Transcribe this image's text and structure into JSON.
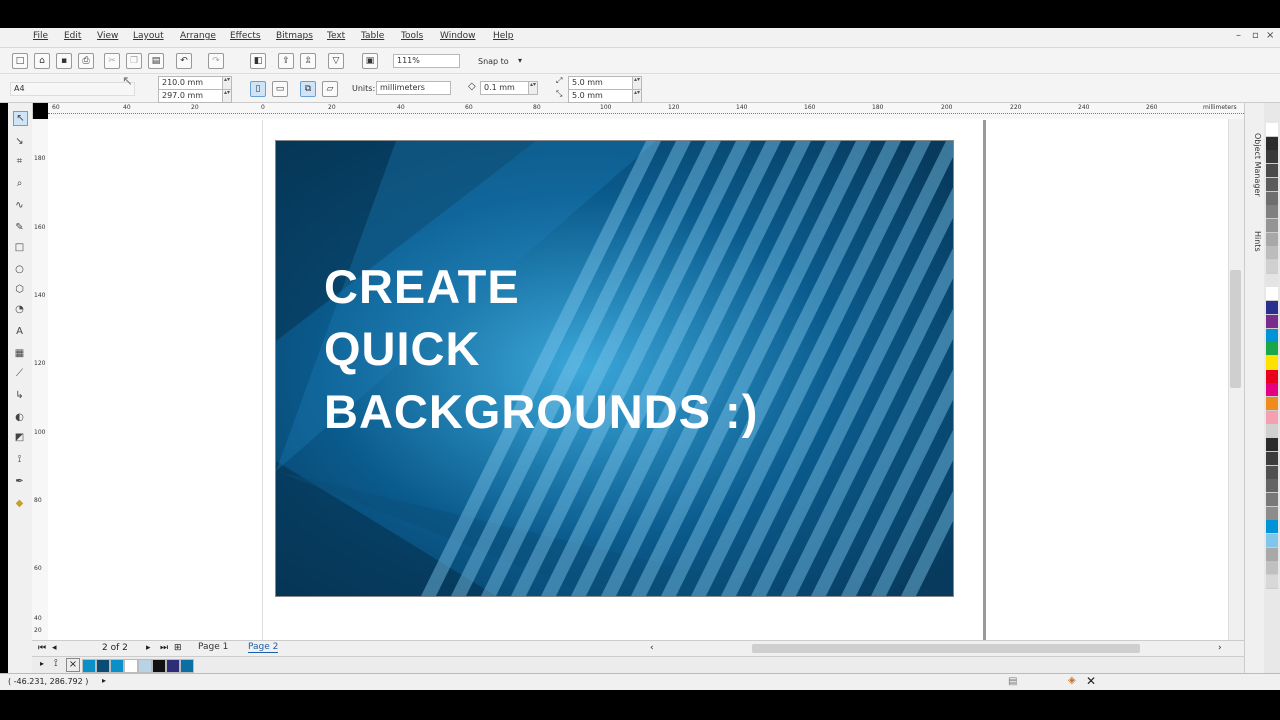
{
  "menu": [
    "File",
    "Edit",
    "View",
    "Layout",
    "Arrange",
    "Effects",
    "Bitmaps",
    "Text",
    "Table",
    "Tools",
    "Window",
    "Help"
  ],
  "toolbar": {
    "zoom": "111%",
    "snap_label": "Snap to"
  },
  "propbar": {
    "page_size": "A4",
    "width": "210.0 mm",
    "height": "297.0 mm",
    "units_label": "Units:",
    "units_value": "millimeters",
    "nudge": "0.1 mm",
    "dup_x": "5.0 mm",
    "dup_y": "5.0 mm"
  },
  "ruler": {
    "h_ticks": [
      "60",
      "40",
      "20",
      "0",
      "20",
      "40",
      "60",
      "80",
      "100",
      "120",
      "140",
      "160",
      "180",
      "200",
      "220",
      "240",
      "260"
    ],
    "units": "millimeters",
    "v_ticks": [
      "180",
      "160",
      "140",
      "120",
      "100",
      "80",
      "60",
      "40",
      "20"
    ]
  },
  "artwork": {
    "lines": [
      "CREATE",
      "QUICK",
      "BACKGROUNDS :)"
    ],
    "colors": {
      "dark": "#073a5c",
      "mid": "#0a5a8c",
      "light": "#3ba7d9",
      "stripe": "#7fc6ea"
    }
  },
  "dockers": [
    "Object Manager",
    "Hints"
  ],
  "pagenav": {
    "count": "2 of 2",
    "tabs": [
      "Page 1",
      "Page 2"
    ]
  },
  "document_palette": [
    "#0b8fc7",
    "#0a4c74",
    "#0a90c9",
    "#ffffff",
    "#b9d3e6",
    "#111111",
    "#2d2d78",
    "#0b6fa3"
  ],
  "palette": [
    "#ffffff",
    "#2b2b2b",
    "#3a3a3a",
    "#4a4a4a",
    "#5c5c5c",
    "#6e6e6e",
    "#808080",
    "#949494",
    "#a8a8a8",
    "#bcbcbc",
    "#d0d0d0",
    "#e4e4e4",
    "#ffffff",
    "#2a2e8f",
    "#7a2c8e",
    "#0094d6",
    "#1aa64a",
    "#ffe100",
    "#e8001c",
    "#e50082",
    "#f08a1a",
    "#f5a0b0",
    "#d0d0d0",
    "#2b2b2b",
    "#3c3c3c",
    "#505050",
    "#646464",
    "#787878",
    "#8c8c8c",
    "#0094d6",
    "#7fc6ea",
    "#a8a8a8",
    "#c0c0c0",
    "#d8d8d8"
  ],
  "status": {
    "coords": "( -46.231, 286.792 )"
  }
}
